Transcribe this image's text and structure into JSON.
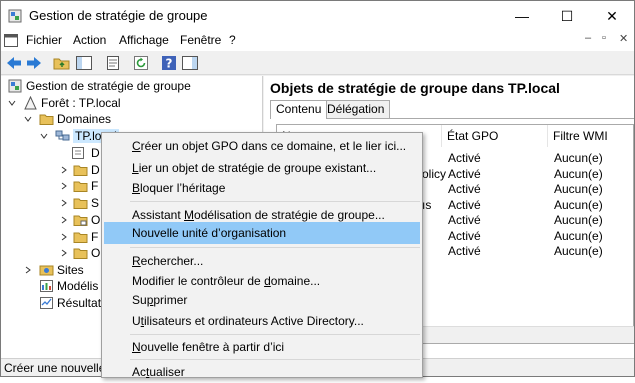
{
  "window": {
    "title": "Gestion de stratégie de groupe"
  },
  "titlebar_buttons": {
    "minimize": "—",
    "maximize": "☐",
    "close": "✕"
  },
  "menu": {
    "items": [
      "Fichier",
      "Action",
      "Affichage",
      "Fenêtre",
      "?"
    ]
  },
  "mdi_controls": {
    "minimize": "–",
    "restore": "▫",
    "close": "✕"
  },
  "tree": {
    "root": "Gestion de stratégie de groupe",
    "forest": "Forêt : TP.local",
    "domains": "Domaines",
    "domain": "TP.local",
    "children": [
      "D",
      "D",
      "F",
      "S",
      "O",
      "F",
      "O"
    ],
    "sites": "Sites",
    "modeling": "Modélis",
    "results": "Résultat"
  },
  "right_pane": {
    "heading": "Objets de stratégie de groupe dans TP.local",
    "tabs": [
      "Contenu",
      "Délégation"
    ],
    "columns": [
      "N",
      "État GPO",
      "Filtre WMI"
    ],
    "rows": [
      {
        "name": "",
        "state": "Activé",
        "wmi": "Aucun(e)"
      },
      {
        "name": "",
        "state": "Activé",
        "wmi": "Aucun(e)"
      },
      {
        "name": "olicy",
        "state": "Activé",
        "wmi": "Aucun(e)"
      },
      {
        "name": "",
        "state": "Activé",
        "wmi": "Aucun(e)"
      },
      {
        "name": "ıs",
        "state": "Activé",
        "wmi": "Aucun(e)"
      },
      {
        "name": "",
        "state": "Activé",
        "wmi": "Aucun(e)"
      },
      {
        "name": "",
        "state": "Activé",
        "wmi": "Aucun(e)"
      }
    ]
  },
  "context_menu": {
    "items": [
      {
        "pre": "",
        "acc": "C",
        "post": "réer un objet GPO dans ce domaine, et le lier ici..."
      },
      {
        "pre": "",
        "acc": "L",
        "post": "ier un objet de stratégie de groupe existant..."
      },
      {
        "pre": "",
        "acc": "B",
        "post": "loquer l’héritage"
      },
      {
        "pre": "Assistant ",
        "acc": "M",
        "post": "odélisation de stratégie de groupe..."
      },
      {
        "pre": "Nouvelle unité d’organisation",
        "acc": "",
        "post": ""
      },
      {
        "pre": "",
        "acc": "R",
        "post": "echercher..."
      },
      {
        "pre": "Modifier le contrôleur de ",
        "acc": "d",
        "post": "omaine..."
      },
      {
        "pre": "Su",
        "acc": "p",
        "post": "primer"
      },
      {
        "pre": "U",
        "acc": "t",
        "post": "ilisateurs et ordinateurs Active Directory..."
      },
      {
        "pre": "",
        "acc": "N",
        "post": "ouvelle fenêtre à partir d’ici"
      },
      {
        "pre": "Ac",
        "acc": "t",
        "post": "ualiser"
      }
    ]
  },
  "status": {
    "text": "Créer une nouvelle u"
  },
  "colors": {
    "highlight": "#91c9f7",
    "selection": "#cce8ff"
  }
}
